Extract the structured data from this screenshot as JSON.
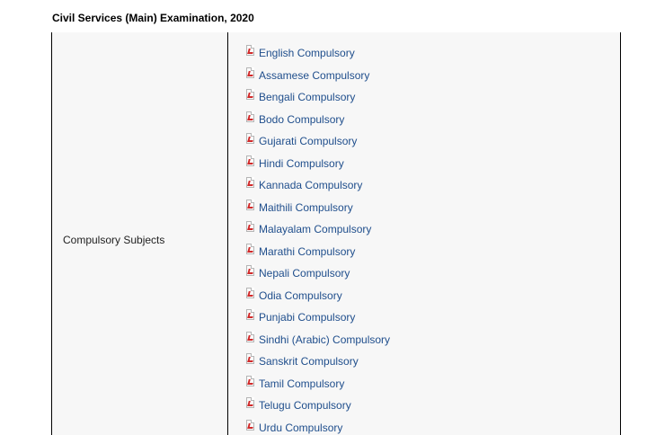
{
  "heading": "Civil Services (Main) Examination, 2020",
  "row_label": "Compulsory Subjects",
  "papers": [
    "English Compulsory",
    "Assamese Compulsory",
    "Bengali Compulsory",
    "Bodo Compulsory",
    "Gujarati Compulsory",
    "Hindi Compulsory",
    "Kannada Compulsory",
    "Maithili Compulsory",
    "Malayalam Compulsory",
    "Marathi Compulsory",
    "Nepali Compulsory",
    "Odia Compulsory",
    "Punjabi Compulsory",
    "Sindhi (Arabic) Compulsory",
    "Sanskrit Compulsory",
    "Tamil Compulsory",
    "Telugu Compulsory",
    "Urdu Compulsory"
  ],
  "icons": {
    "paper_link": "pdf-icon"
  },
  "colors": {
    "link": "#1f4e8c",
    "pdf_accent": "#d12a2a"
  }
}
